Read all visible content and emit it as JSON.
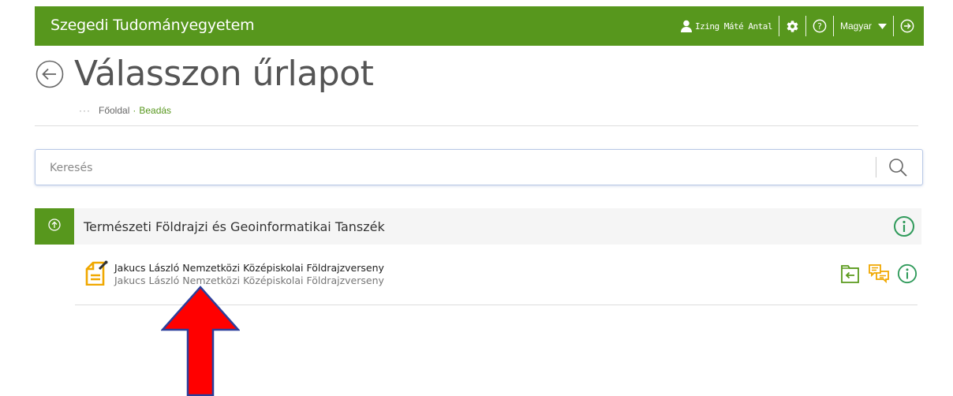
{
  "header": {
    "brand": "Szegedi Tudományegyetem",
    "user_name": "Izing Máté Antal",
    "language": "Magyar",
    "icons": [
      "user-icon",
      "gear-icon",
      "help-icon",
      "chevron-down-icon",
      "logout-icon"
    ]
  },
  "page": {
    "title": "Válasszon űrlapot",
    "breadcrumb": {
      "dots": "···",
      "home": "Főoldal",
      "separator": "·",
      "current": "Beadás"
    }
  },
  "search": {
    "placeholder": "Keresés",
    "value": ""
  },
  "department": {
    "name": "Természeti Földrajzi és Geoinformatikai Tanszék",
    "forms": [
      {
        "title": "Jakucs László Nemzetközi Középiskolai Földrajzverseny",
        "subtitle": "Jakucs László Nemzetközi Középiskolai Földrajzverseny",
        "actions": [
          "submit-folder-icon",
          "messages-icon",
          "info-icon"
        ]
      }
    ]
  },
  "colors": {
    "brand_green": "#57971d",
    "action_orange": "#f0a800",
    "info_green": "#2f9a5a",
    "annotation_red": "#ff0000",
    "annotation_border": "#2b3e9b"
  }
}
